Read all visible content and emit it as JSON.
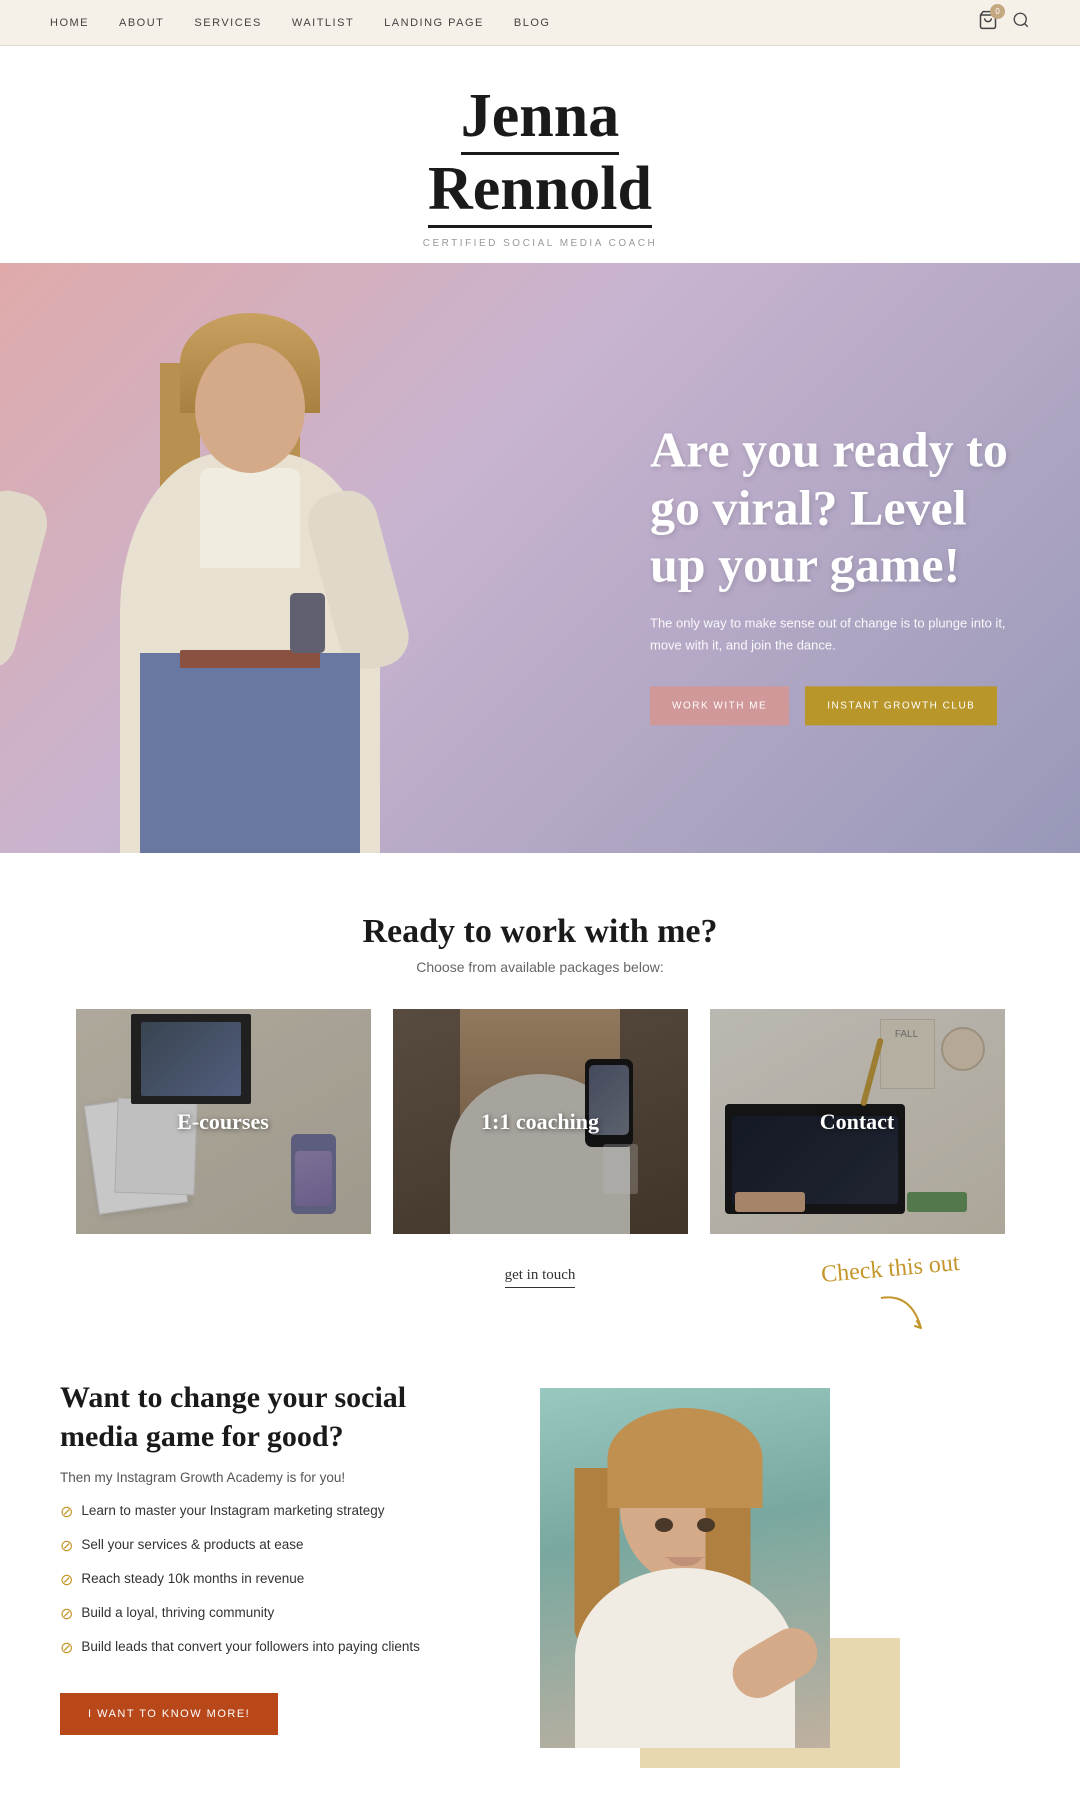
{
  "nav": {
    "links": [
      {
        "label": "HOME",
        "id": "home"
      },
      {
        "label": "ABOUT",
        "id": "about"
      },
      {
        "label": "SERVICES",
        "id": "services"
      },
      {
        "label": "WAITLIST",
        "id": "waitlist"
      },
      {
        "label": "LANDING PAGE",
        "id": "landing-page"
      },
      {
        "label": "BLOG",
        "id": "blog"
      }
    ],
    "cart_count": "0"
  },
  "header": {
    "name_line1": "Jenna",
    "name_line2": "Rennold",
    "subtitle": "CERTIFIED SOCIAL MEDIA COACH"
  },
  "hero": {
    "title": "Are you ready to go viral? Level up your game!",
    "subtitle": "The only way to make sense out of change is to plunge into it, move with it, and join the dance.",
    "btn_work": "WORK WITH ME",
    "btn_growth": "INSTANT GROWTH CLUB"
  },
  "packages": {
    "title": "Ready to work with me?",
    "subtitle": "Choose from available packages below:",
    "cards": [
      {
        "label": "E-courses",
        "id": "ecourses"
      },
      {
        "label": "1:1 coaching",
        "id": "coaching"
      },
      {
        "label": "Contact",
        "id": "contact"
      }
    ],
    "get_in_touch": "get in touch"
  },
  "check_this_out": {
    "text": "Check this out"
  },
  "bottom": {
    "title": "Want to change your social media game for good?",
    "desc": "Then my Instagram Growth Academy is for you!",
    "checklist": [
      "Learn to master your Instagram marketing strategy",
      "Sell your services & products at ease",
      "Reach steady 10k months in revenue",
      "Build a loyal, thriving community",
      "Build leads that convert your followers into paying clients"
    ],
    "btn_label": "I WANT TO KNOW MORE!"
  }
}
